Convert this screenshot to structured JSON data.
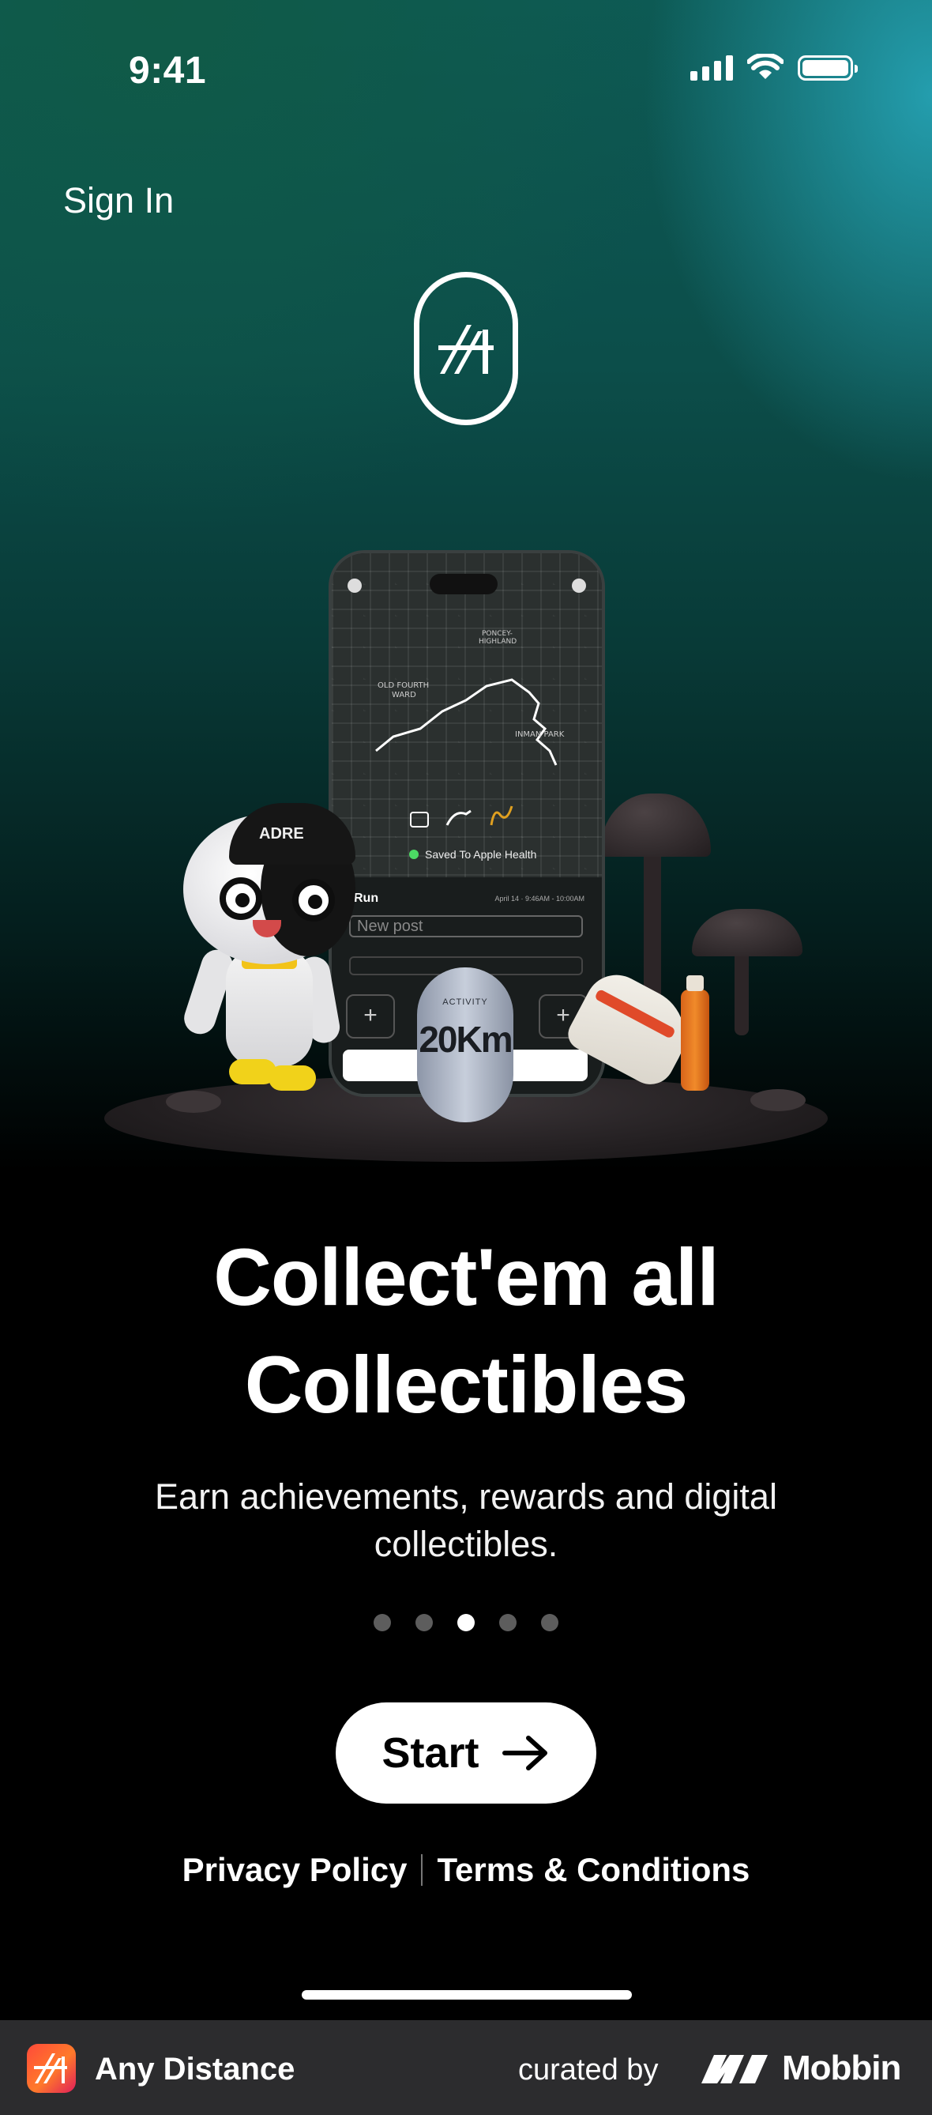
{
  "status_bar": {
    "time": "9:41"
  },
  "header": {
    "sign_in": "Sign In"
  },
  "illustration": {
    "phone": {
      "post_placeholder": "New post",
      "activity_type": "Run",
      "activity_date": "April 14 · 9:46AM - 10:00AM",
      "health_status": "Saved To Apple Health",
      "plus_label": "+"
    },
    "badge": {
      "caption": "ACTIVITY",
      "value": "20Km"
    },
    "cap_text": "ADRE"
  },
  "onboarding": {
    "headline_line1": "Collect'em all",
    "headline_line2": "Collectibles",
    "subtext": "Earn achievements, rewards and digital collectibles.",
    "page_count": 5,
    "active_page": 3
  },
  "actions": {
    "start_label": "Start"
  },
  "legal": {
    "privacy": "Privacy Policy",
    "terms": "Terms & Conditions"
  },
  "footer": {
    "app_name": "Any Distance",
    "curated_by": "curated by",
    "brand": "Mobbin"
  },
  "icons": [
    "signal-icon",
    "wifi-icon",
    "battery-icon",
    "app-logo-icon",
    "arrow-right-icon",
    "mobbin-logo-icon"
  ]
}
